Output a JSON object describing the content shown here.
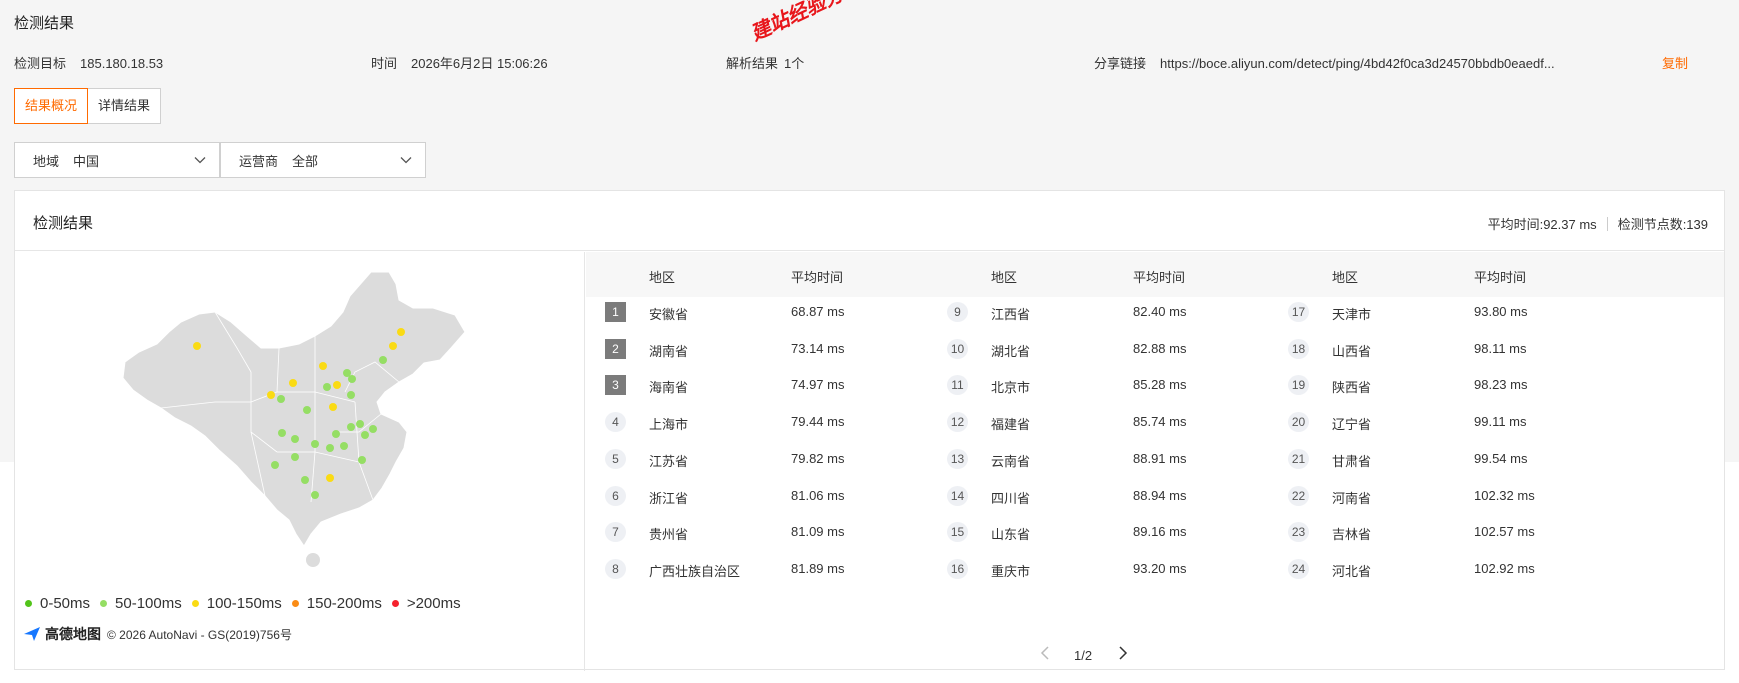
{
  "page": {
    "title": "检测结果",
    "target_label": "检测目标",
    "target_value": "185.180.18.53",
    "time_label": "时间",
    "time_value": "2026年6月2日 15:06:26",
    "resolve_label": "解析结果",
    "resolve_value": "1个",
    "share_label": "分享链接",
    "share_value": "https://boce.aliyun.com/detect/ping/4bd42f0ca3d24570bbdb0eaedf...",
    "copy_label": "复制",
    "watermark": "建站经验分享-www.w..."
  },
  "tabs": [
    {
      "label": "结果概况",
      "active": true
    },
    {
      "label": "详情结果",
      "active": false
    }
  ],
  "filters": {
    "region_label": "地域",
    "region_value": "中国",
    "isp_label": "运营商",
    "isp_value": "全部"
  },
  "panel": {
    "title": "检测结果",
    "avg_time": "平均时间:92.37 ms",
    "node_count": "检测节点数:139"
  },
  "legend": [
    {
      "label": "0-50ms",
      "color": "#52c41a"
    },
    {
      "label": "50-100ms",
      "color": "#95de64"
    },
    {
      "label": "100-150ms",
      "color": "#fadb14"
    },
    {
      "label": "150-200ms",
      "color": "#fa8c16"
    },
    {
      "label": ">200ms",
      "color": "#f5222d"
    }
  ],
  "map_credit": {
    "logo_text": "高德地图",
    "copyright": "© 2026 AutoNavi - GS(2019)756号"
  },
  "table": {
    "col_region": "地区",
    "col_avg": "平均时间",
    "columns": [
      [
        {
          "rank": "1",
          "region": "安徽省",
          "avg": "68.87 ms"
        },
        {
          "rank": "2",
          "region": "湖南省",
          "avg": "73.14 ms"
        },
        {
          "rank": "3",
          "region": "海南省",
          "avg": "74.97 ms"
        },
        {
          "rank": "4",
          "region": "上海市",
          "avg": "79.44 ms"
        },
        {
          "rank": "5",
          "region": "江苏省",
          "avg": "79.82 ms"
        },
        {
          "rank": "6",
          "region": "浙江省",
          "avg": "81.06 ms"
        },
        {
          "rank": "7",
          "region": "贵州省",
          "avg": "81.09 ms"
        },
        {
          "rank": "8",
          "region": "广西壮族自治区",
          "avg": "81.89 ms"
        }
      ],
      [
        {
          "rank": "9",
          "region": "江西省",
          "avg": "82.40 ms"
        },
        {
          "rank": "10",
          "region": "湖北省",
          "avg": "82.88 ms"
        },
        {
          "rank": "11",
          "region": "北京市",
          "avg": "85.28 ms"
        },
        {
          "rank": "12",
          "region": "福建省",
          "avg": "85.74 ms"
        },
        {
          "rank": "13",
          "region": "云南省",
          "avg": "88.91 ms"
        },
        {
          "rank": "14",
          "region": "四川省",
          "avg": "88.94 ms"
        },
        {
          "rank": "15",
          "region": "山东省",
          "avg": "89.16 ms"
        },
        {
          "rank": "16",
          "region": "重庆市",
          "avg": "93.20 ms"
        }
      ],
      [
        {
          "rank": "17",
          "region": "天津市",
          "avg": "93.80 ms"
        },
        {
          "rank": "18",
          "region": "山西省",
          "avg": "98.11 ms"
        },
        {
          "rank": "19",
          "region": "陕西省",
          "avg": "98.23 ms"
        },
        {
          "rank": "20",
          "region": "辽宁省",
          "avg": "99.11 ms"
        },
        {
          "rank": "21",
          "region": "甘肃省",
          "avg": "99.54 ms"
        },
        {
          "rank": "22",
          "region": "河南省",
          "avg": "102.32 ms"
        },
        {
          "rank": "23",
          "region": "吉林省",
          "avg": "102.57 ms"
        },
        {
          "rank": "24",
          "region": "河北省",
          "avg": "102.92 ms"
        }
      ]
    ],
    "pagination": "1/2"
  }
}
